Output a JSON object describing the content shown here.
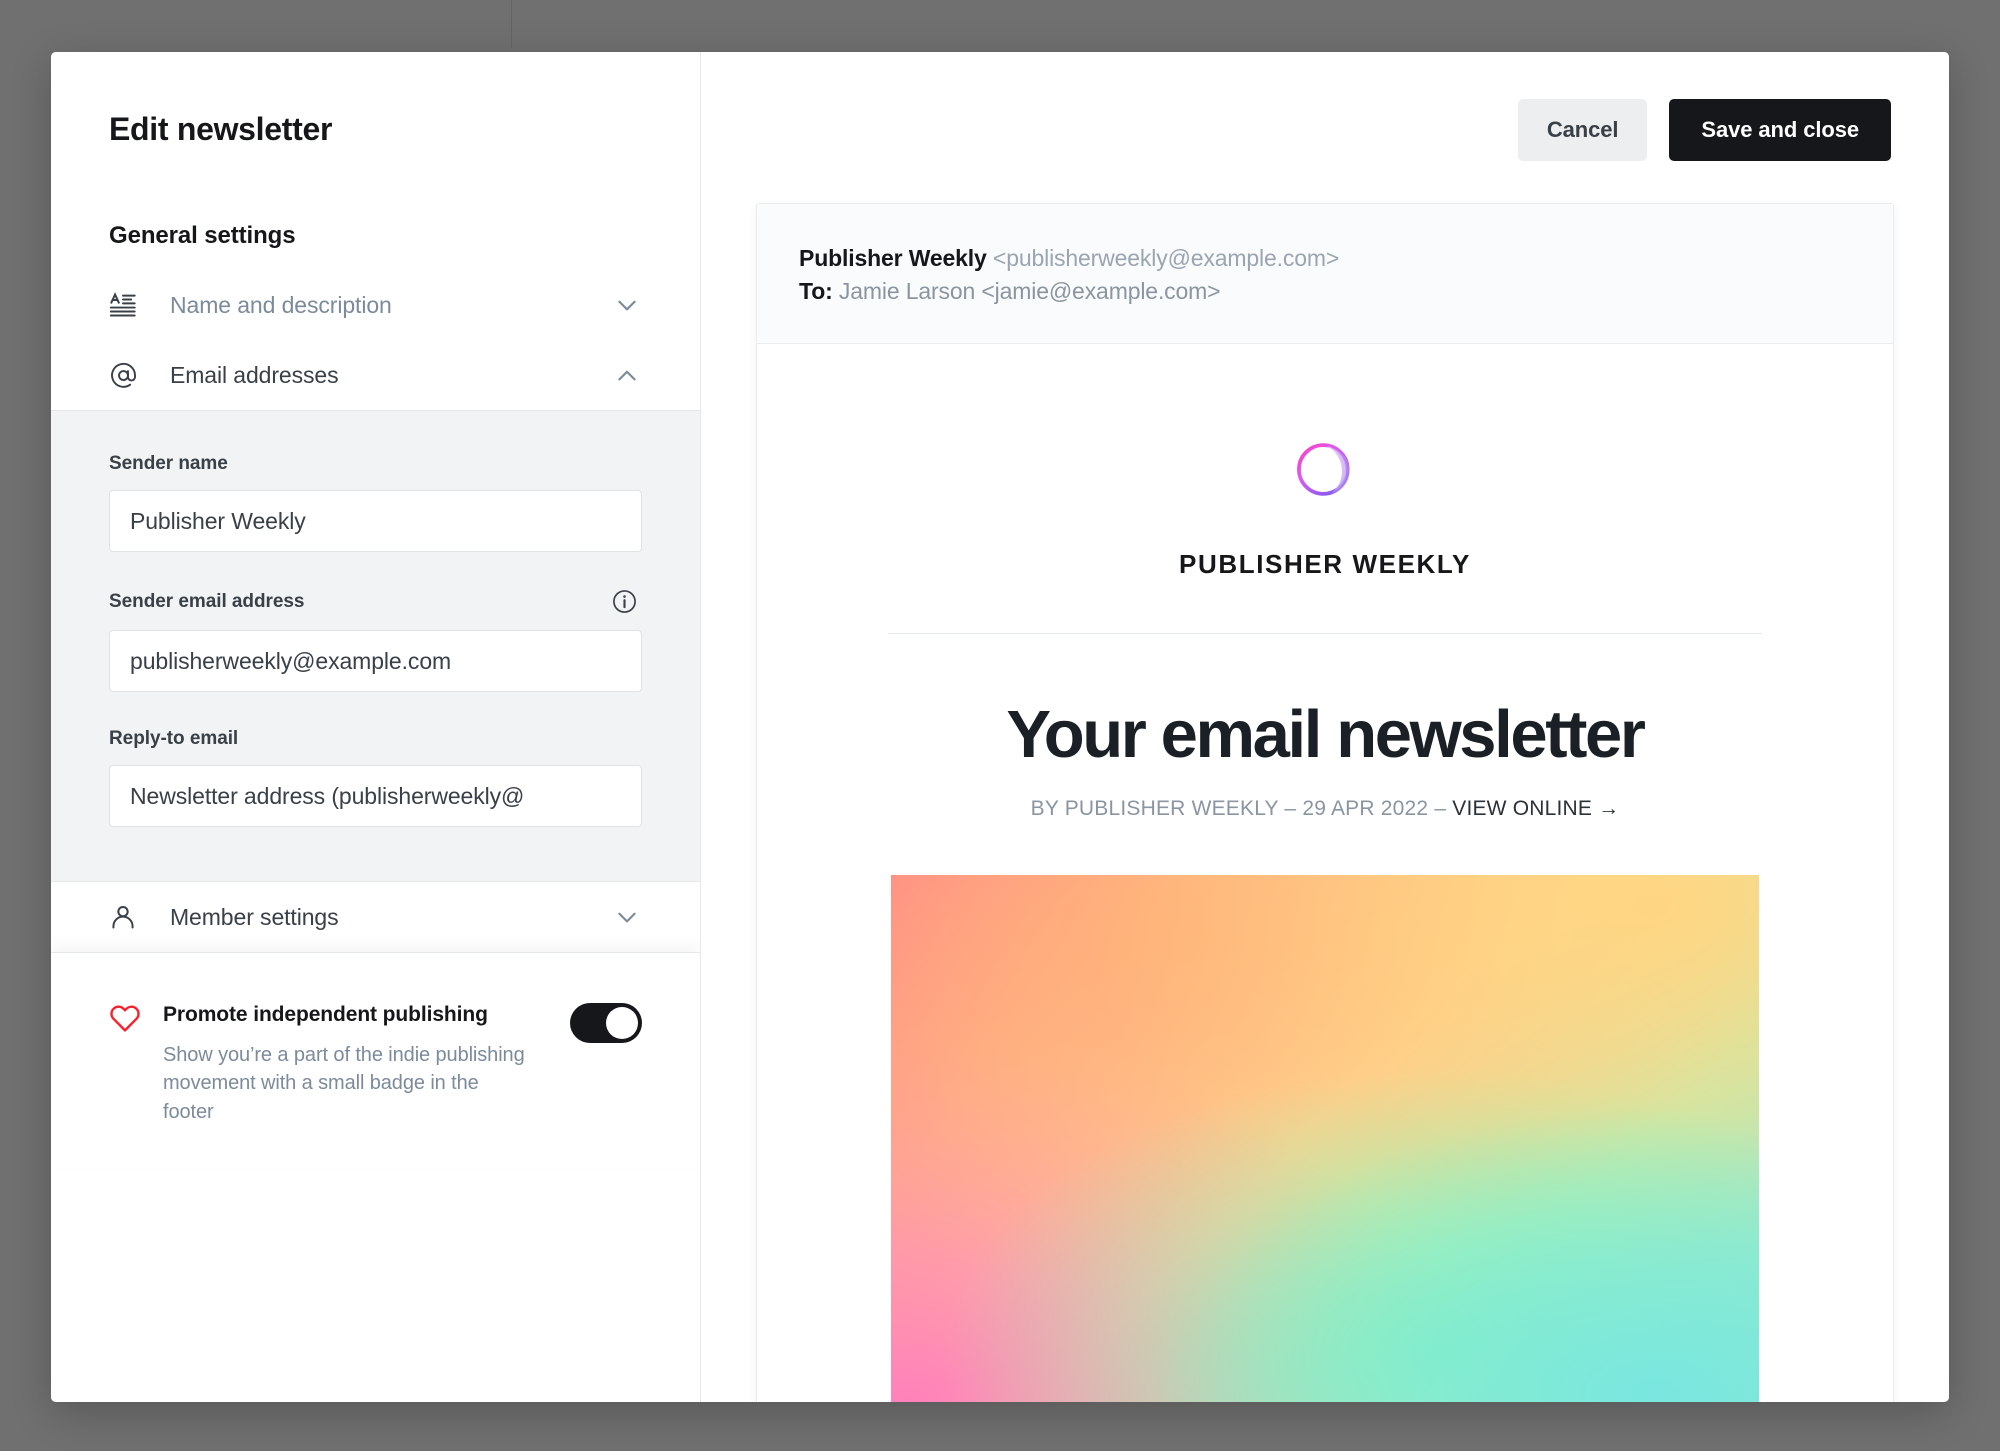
{
  "modal": {
    "title": "Edit newsletter",
    "section_heading": "General settings"
  },
  "sidebar": {
    "nav_items": [
      {
        "label": "Name and description",
        "icon": "typography-icon",
        "state": "collapsed",
        "chevron": "chevron-down-icon"
      },
      {
        "label": "Email addresses",
        "icon": "at-sign-icon",
        "state": "expanded",
        "chevron": "chevron-up-icon"
      },
      {
        "label": "Member settings",
        "icon": "person-icon",
        "state": "collapsed",
        "chevron": "chevron-down-icon"
      }
    ],
    "email_form": {
      "sender_name": {
        "label": "Sender name",
        "value": "Publisher Weekly"
      },
      "sender_email": {
        "label": "Sender email address",
        "value": "publisherweekly@example.com",
        "info_icon": "info-circle-icon"
      },
      "reply_to": {
        "label": "Reply-to email",
        "value": "Newsletter address (publisherweekly@"
      }
    },
    "promote": {
      "icon": "heart-icon",
      "title": "Promote independent publishing",
      "description": "Show you’re a part of the indie publishing movement with a small badge in the footer",
      "toggle_state": "on"
    }
  },
  "toolbar": {
    "cancel_label": "Cancel",
    "save_label": "Save and close"
  },
  "preview": {
    "email_header": {
      "from_name": "Publisher Weekly",
      "from_address": "<publisherweekly@example.com>",
      "to_label": "To:",
      "to_value": "Jamie Larson <jamie@example.com>"
    },
    "newsletter": {
      "logo": "publisher-weekly-logo",
      "brand_name": "PUBLISHER WEEKLY",
      "title": "Your email newsletter",
      "byline_prefix": "BY PUBLISHER WEEKLY – 29 APR 2022 – ",
      "byline_link": "VIEW ONLINE →",
      "feature_image": "gradient-feature-image"
    }
  },
  "colors": {
    "accent_dark": "#15171a",
    "heart_red": "#f5222d",
    "muted_text": "#7c8b9a",
    "panel_bg": "#f1f3f4",
    "backdrop": "#707070"
  }
}
